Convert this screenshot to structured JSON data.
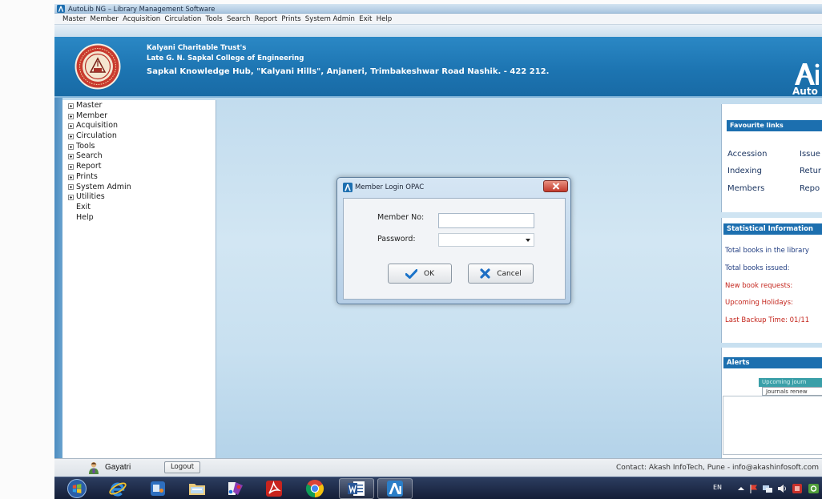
{
  "window": {
    "title": "AutoLib NG – Library Management Software",
    "app_icon": "autolib-app-icon"
  },
  "menu": {
    "items": [
      "Master",
      "Member",
      "Acquisition",
      "Circulation",
      "Tools",
      "Search",
      "Report",
      "Prints",
      "System Admin",
      "Exit",
      "Help"
    ]
  },
  "header": {
    "logo": "college-emblem-logo",
    "line1": "Kalyani Charitable Trust's",
    "line2": "Late G. N. Sapkal College of Engineering",
    "line3": "Sapkal Knowledge Hub, \"Kalyani Hills\", Anjaneri, Trimbakeshwar Road Nashik. - 422 212.",
    "brand_logo": "autolib-logo",
    "brand_text": "Auto"
  },
  "sidebar": {
    "items": [
      {
        "label": "Master",
        "expandable": true
      },
      {
        "label": "Member",
        "expandable": true
      },
      {
        "label": "Acquisition",
        "expandable": true
      },
      {
        "label": "Circulation",
        "expandable": true
      },
      {
        "label": "Tools",
        "expandable": true
      },
      {
        "label": "Search",
        "expandable": true
      },
      {
        "label": "Report",
        "expandable": true
      },
      {
        "label": "Prints",
        "expandable": true
      },
      {
        "label": "System Admin",
        "expandable": true
      },
      {
        "label": "Utilities",
        "expandable": true
      },
      {
        "label": "Exit",
        "expandable": false
      },
      {
        "label": "Help",
        "expandable": false
      }
    ]
  },
  "dialog": {
    "title": "Member Login OPAC",
    "member_no_label": "Member No:",
    "member_no_value": "",
    "password_label": "Password:",
    "password_value": "",
    "ok_label": "OK",
    "cancel_label": "Cancel"
  },
  "favourites": {
    "title": "Favourite links",
    "links": [
      "Accession",
      "Issue",
      "Indexing",
      "Retur",
      "Members",
      "Repo"
    ]
  },
  "statistics": {
    "title": "Statistical Information",
    "rows": [
      {
        "text": "Total books in the library",
        "color": "#1f3c80"
      },
      {
        "text": "Total books issued:",
        "color": "#1f3c80"
      },
      {
        "text": "New book requests:",
        "color": "#c4251c"
      },
      {
        "text": "Upcoming Holidays:",
        "color": "#c4251c"
      },
      {
        "text": "Last Backup Time: 01/11",
        "color": "#c4251c"
      }
    ]
  },
  "alerts": {
    "title": "Alerts",
    "tabs": [
      {
        "label": "Upcoming journ",
        "selected": true
      },
      {
        "label": "Journals renew",
        "selected": false
      }
    ]
  },
  "status_bar": {
    "user": "Gayatri",
    "logout_label": "Logout",
    "contact": "Contact: Akash InfoTech, Pune - info@akashinfosoft.com"
  },
  "taskbar": {
    "pinned": [
      "start-button",
      "internet-explorer-icon",
      "media-player-icon",
      "file-explorer-icon",
      "paint-icon",
      "adobe-reader-icon",
      "chrome-icon",
      "word-icon",
      "autolib-taskbar-icon"
    ],
    "language": "EN"
  },
  "colors": {
    "header_bg": "#1d75b2",
    "panel_header": "#1c6faf",
    "stat_blue": "#1f3c80",
    "stat_red": "#c4251c",
    "alert_tab": "#3a9fa8",
    "taskbar": "#141e37"
  }
}
